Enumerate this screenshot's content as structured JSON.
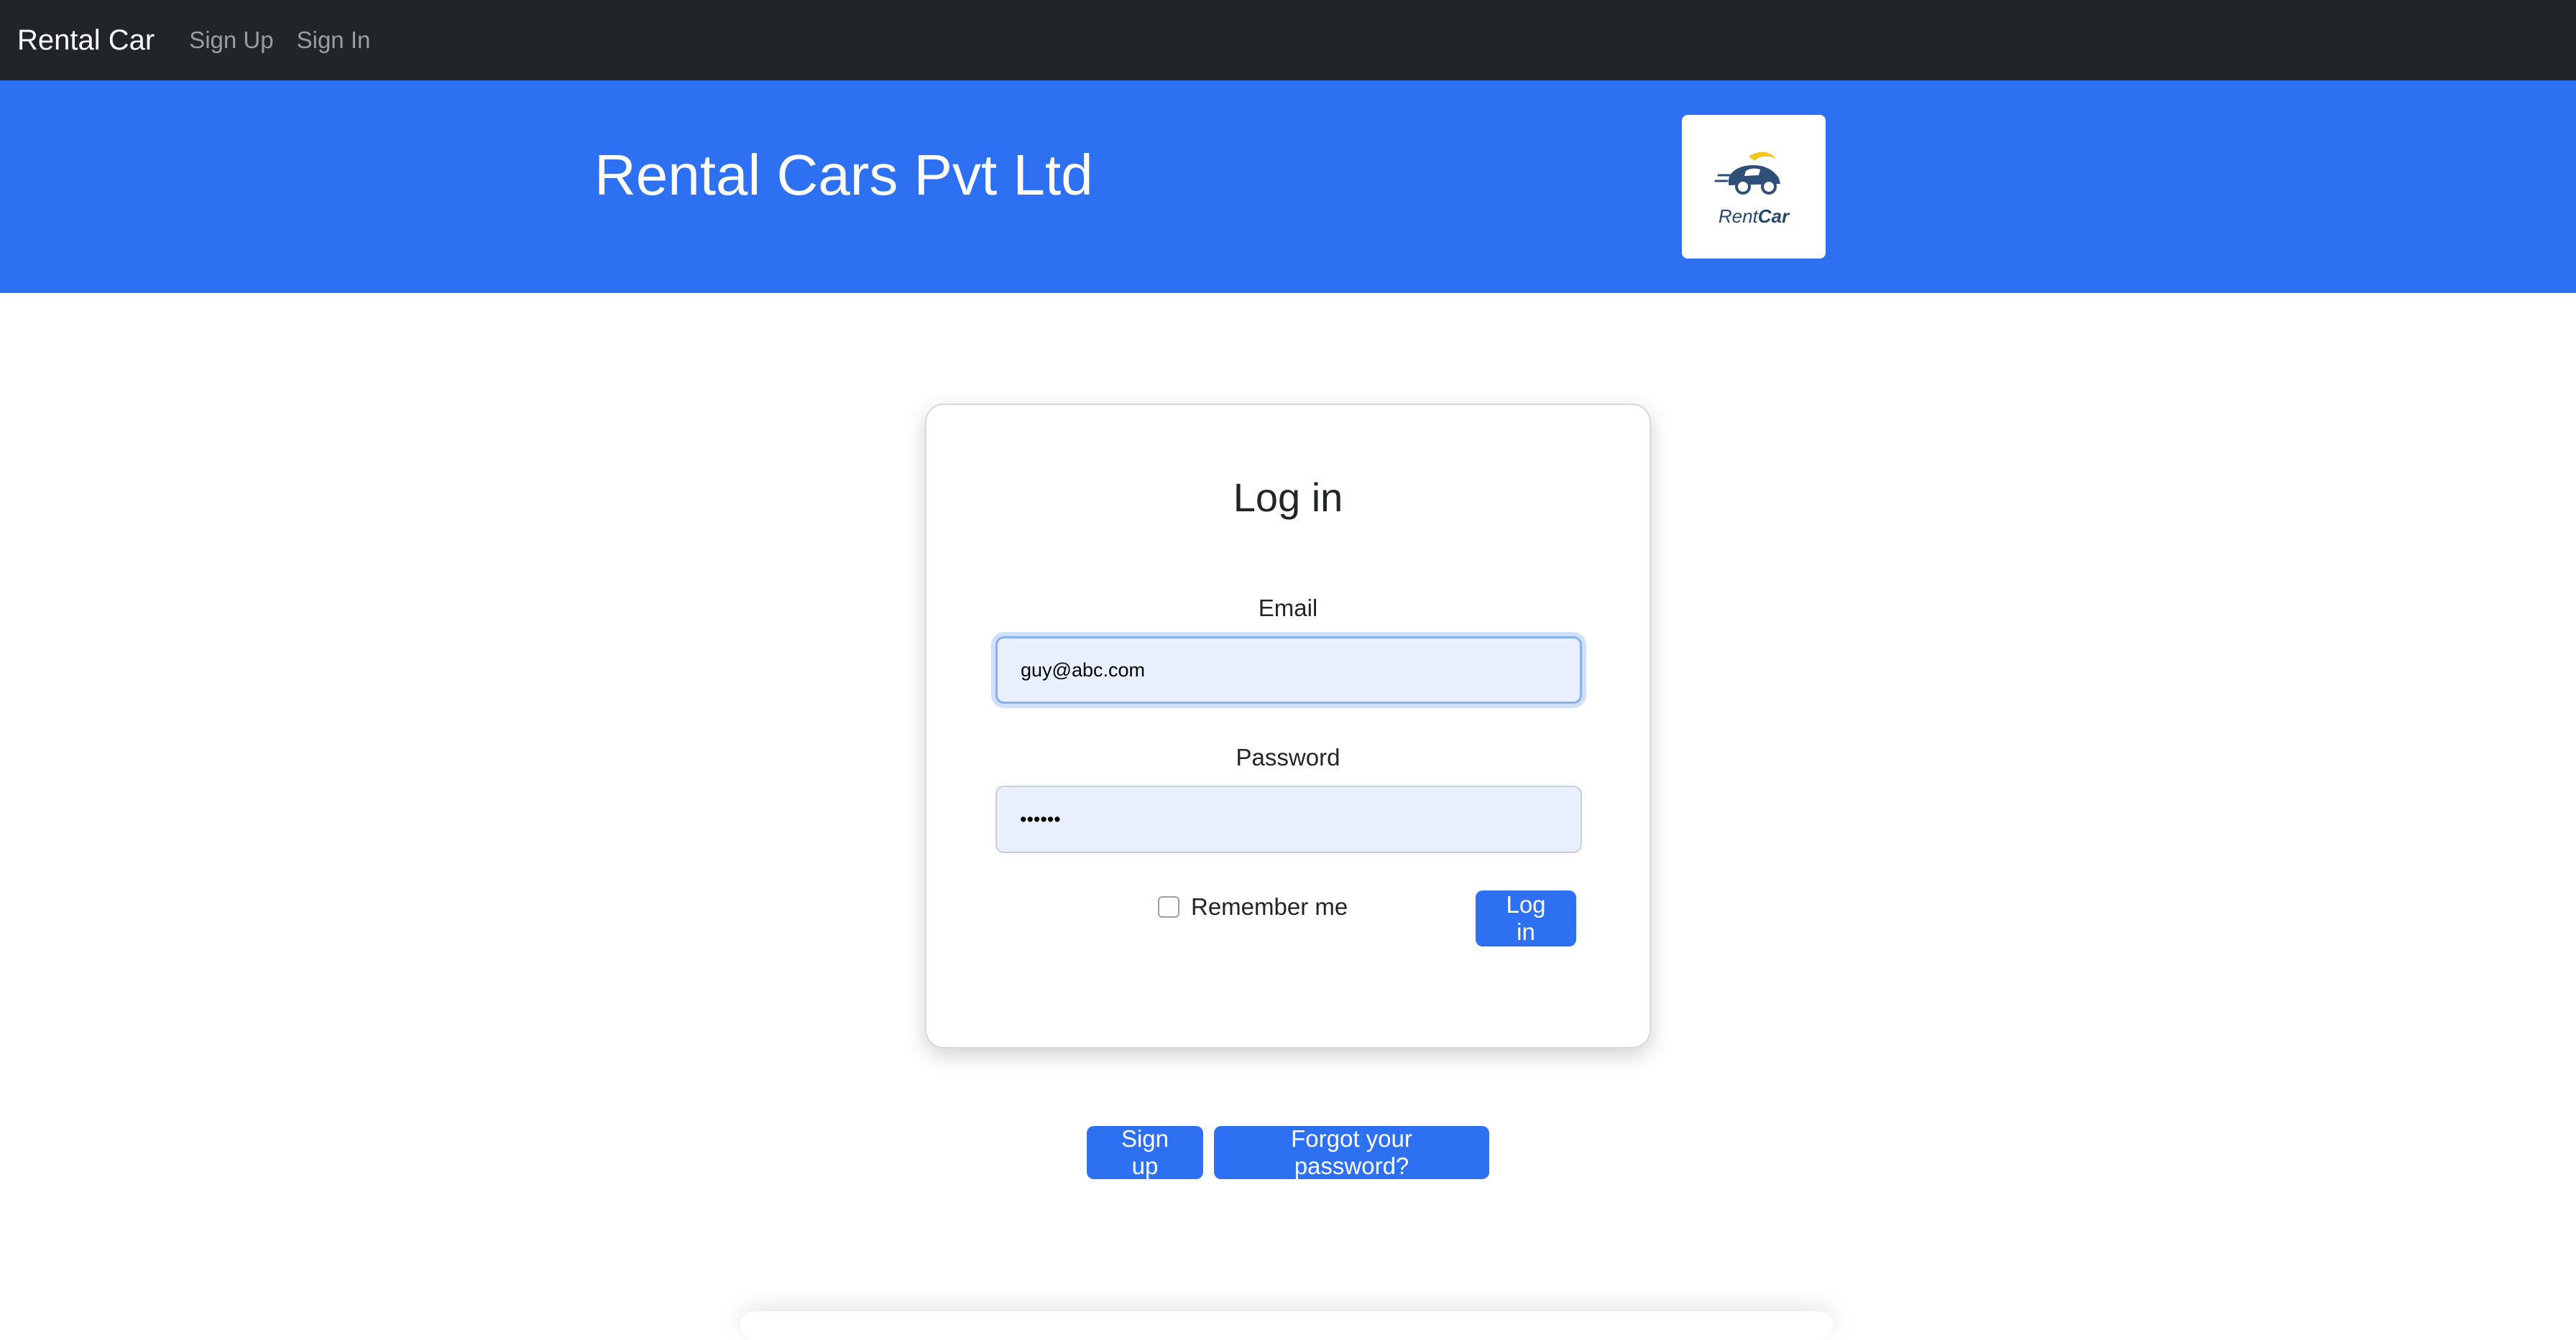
{
  "navbar": {
    "brand": "Rental Car",
    "links": [
      "Sign Up",
      "Sign In"
    ]
  },
  "hero": {
    "title": "Rental Cars Pvt Ltd",
    "logo": {
      "text_regular": "Rent",
      "text_bold": "Car",
      "icon": "car-logo-icon"
    }
  },
  "login": {
    "title": "Log in",
    "email_label": "Email",
    "email_value": "guy@abc.com",
    "password_label": "Password",
    "password_value": "••••••",
    "remember_label": "Remember me",
    "remember_checked": false,
    "submit_label": "Log in"
  },
  "footer_links": {
    "signup_label": "Sign up",
    "forgot_label": "Forgot your password?"
  },
  "colors": {
    "navbar": "#212529",
    "primary": "#2d70f2",
    "input_autofill": "#e8f0fe"
  }
}
